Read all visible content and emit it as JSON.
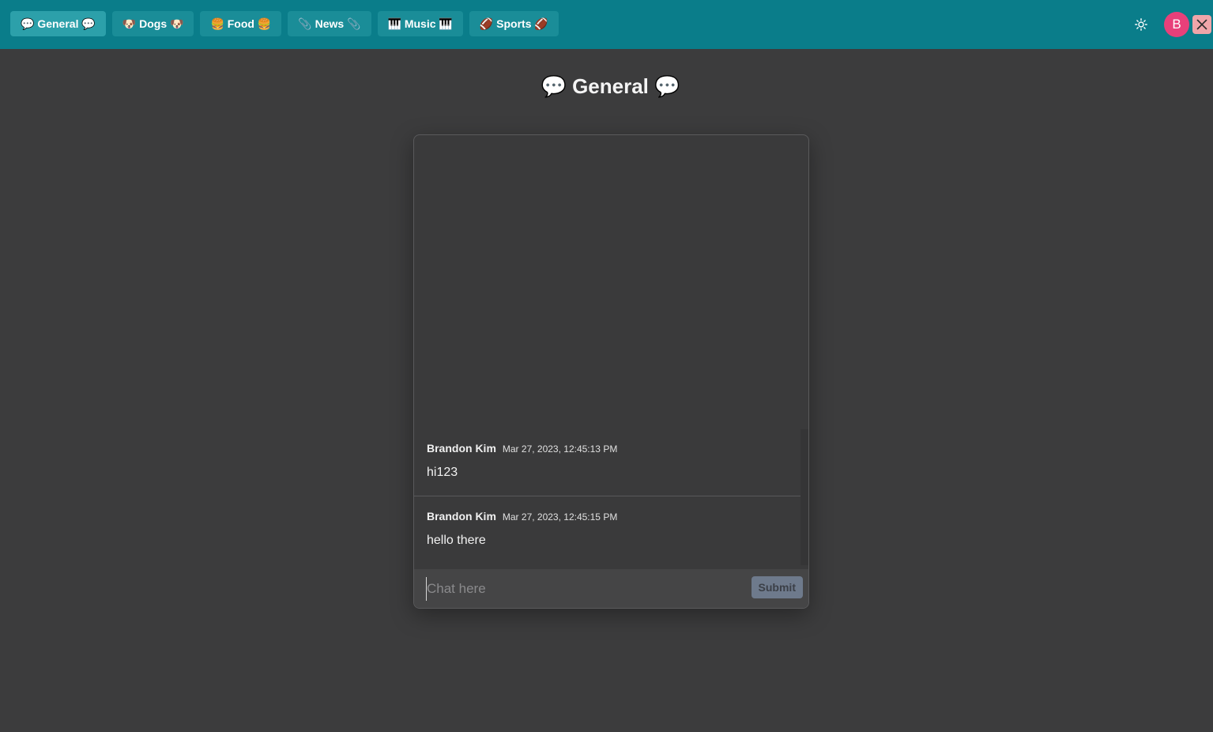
{
  "tabs": [
    {
      "label": "💬 General 💬",
      "active": true
    },
    {
      "label": "🐶 Dogs 🐶",
      "active": false
    },
    {
      "label": "🍔 Food 🍔",
      "active": false
    },
    {
      "label": "📎 News 📎",
      "active": false
    },
    {
      "label": "🎹 Music 🎹",
      "active": false
    },
    {
      "label": "🏈 Sports 🏈",
      "active": false
    }
  ],
  "header": {
    "theme_icon": "sun-icon",
    "avatar_initial": "B",
    "close_icon": "close-icon"
  },
  "room": {
    "title": "💬 General 💬"
  },
  "messages": [
    {
      "author": "Brandon Kim",
      "time": "Mar 27, 2023, 12:45:13 PM",
      "text": "hi123"
    },
    {
      "author": "Brandon Kim",
      "time": "Mar 27, 2023, 12:45:15 PM",
      "text": "hello there"
    }
  ],
  "composer": {
    "placeholder": "Chat here",
    "value": "",
    "submit_label": "Submit"
  },
  "colors": {
    "topbar": "#0a7d8a",
    "background": "#3c3c3d",
    "avatar": "#e8407a",
    "close": "#f0a5a9",
    "submit": "#6e7a8c"
  }
}
